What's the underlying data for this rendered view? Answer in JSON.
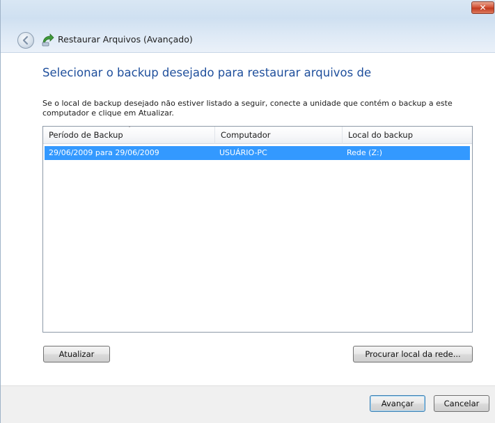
{
  "window": {
    "title": "Restaurar Arquivos (Avançado)",
    "close_label": "✕"
  },
  "main": {
    "heading": "Selecionar o backup desejado para restaurar arquivos de",
    "instructions": "Se o local de backup desejado não estiver listado a seguir, conecte a unidade que contém o backup a este computador e clique em Atualizar."
  },
  "table": {
    "columns": [
      "Período de Backup",
      "Computador",
      "Local do backup"
    ],
    "rows": [
      {
        "periodo": "29/06/2009 para 29/06/2009",
        "computador": "USUÁRIO-PC",
        "local": "Rede (Z:)",
        "selected": true
      }
    ]
  },
  "buttons": {
    "refresh": "Atualizar",
    "browse_network": "Procurar local da rede...",
    "next": "Avançar",
    "cancel": "Cancelar"
  },
  "colors": {
    "heading": "#1f4f9c",
    "selection": "#3399ff"
  },
  "icons": {
    "back": "back-arrow-icon",
    "app": "backup-restore-icon",
    "close": "close-icon"
  }
}
